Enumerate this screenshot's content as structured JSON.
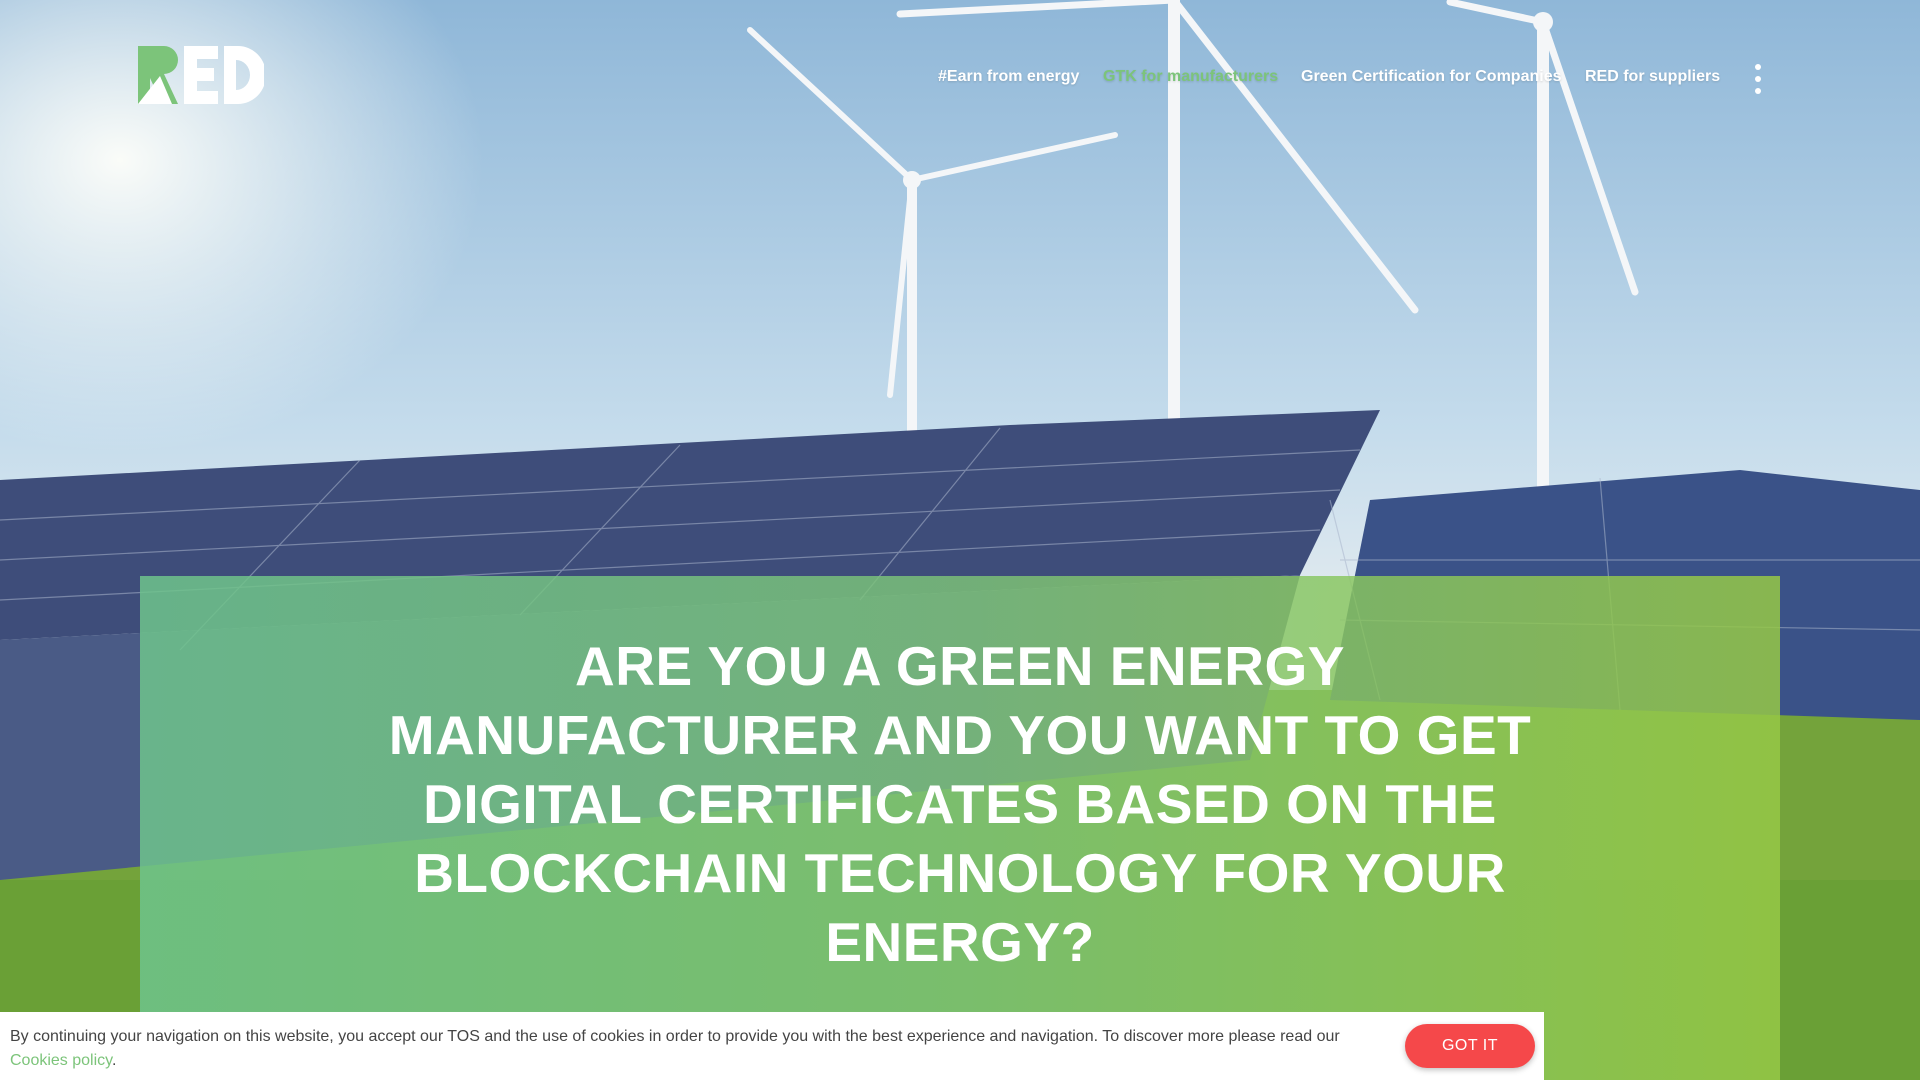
{
  "nav": {
    "items": [
      {
        "label": "#Earn from energy",
        "active": false
      },
      {
        "label": "GTK for manufacturers",
        "active": true
      },
      {
        "label": "Green Certification for Companies",
        "active": false
      },
      {
        "label": "RED for suppliers",
        "active": false
      }
    ],
    "menu_icon": "more-vertical-icon"
  },
  "logo": {
    "text": "RED",
    "colors": [
      "#7cc47a",
      "#ffffff"
    ]
  },
  "hero": {
    "headline_lines": [
      "ARE YOU A GREEN ENERGY",
      "MANUFACTURER AND YOU WANT TO GET",
      "DIGITAL CERTIFICATES BASED ON THE",
      "BLOCKCHAIN TECHNOLOGY FOR YOUR",
      "ENERGY?"
    ]
  },
  "cookie": {
    "text": "By continuing your navigation on this website, you accept our TOS and the use of cookies in order to provide you with the best experience and navigation. To discover more please read our",
    "link_label": "Cookies policy",
    "after_link": ".",
    "button_label": "GOT IT"
  },
  "colors": {
    "accent": "#7cc47a",
    "button": "#f5484a",
    "overlay": "#7cc48c"
  }
}
